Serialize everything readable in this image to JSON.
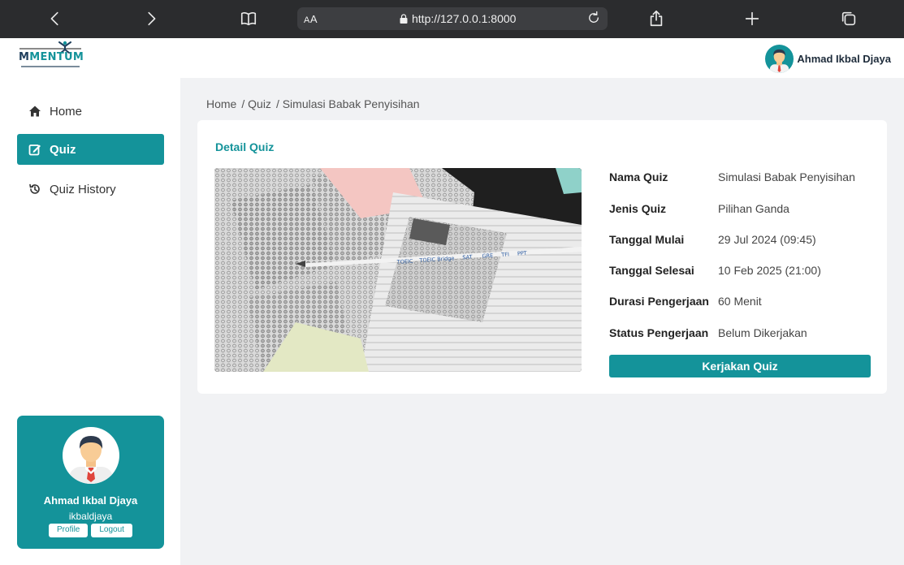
{
  "browser": {
    "aa_label_small": "A",
    "aa_label_big": "A",
    "url": "http://127.0.0.1:8000"
  },
  "header": {
    "logo_text_main": "M",
    "logo_text_accent": "MENTUM",
    "user_name": "Ahmad Ikbal Djaya"
  },
  "sidebar": {
    "items": [
      {
        "label": "Home",
        "icon": "home-icon"
      },
      {
        "label": "Quiz",
        "icon": "edit-icon",
        "active": true
      },
      {
        "label": "Quiz History",
        "icon": "history-icon"
      }
    ],
    "profile": {
      "name": "Ahmad Ikbal Djaya",
      "username": "ikbaldjaya",
      "profile_label": "Profile",
      "logout_label": "Logout"
    }
  },
  "breadcrumb": [
    "Home",
    "/ Quiz",
    "/ Simulasi Babak Penyisihan"
  ],
  "detail": {
    "title": "Detail Quiz",
    "rows": [
      {
        "key": "Nama Quiz",
        "value": "Simulasi Babak Penyisihan"
      },
      {
        "key": "Jenis Quiz",
        "value": "Pilihan Ganda"
      },
      {
        "key": "Tanggal Mulai",
        "value": "29 Jul 2024 (09:45)"
      },
      {
        "key": "Tanggal Selesai",
        "value": "10 Feb 2025 (21:00)"
      },
      {
        "key": "Durasi Pengerjaan",
        "value": "60 Menit"
      },
      {
        "key": "Status Pengerjaan",
        "value": "Belum Dikerjakan"
      }
    ],
    "button_label": "Kerjakan Quiz"
  },
  "image_text": {
    "pencil_labels": [
      "TOEIC",
      "TOEIC Bridge",
      "SAT",
      "GRE",
      "TFI",
      "PPT"
    ]
  },
  "colors": {
    "accent": "#14939a",
    "background": "#f1f2f4",
    "browser_bar": "#2b2c2e"
  }
}
